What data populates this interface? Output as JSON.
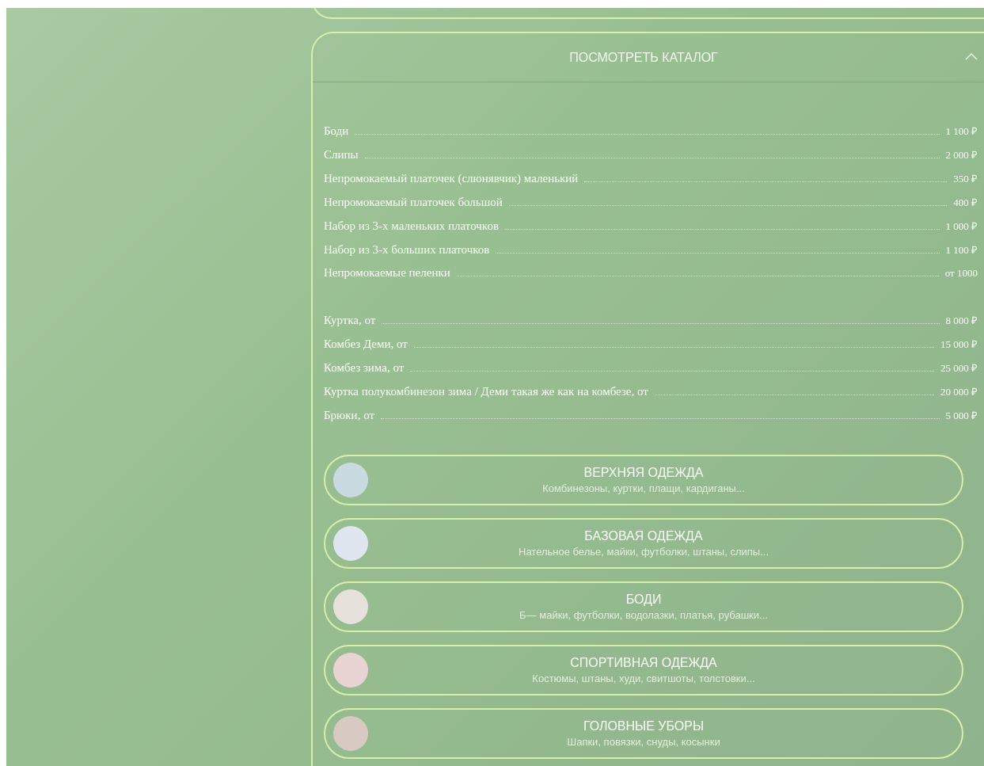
{
  "catalog": {
    "title": "ПОСМОТРЕТЬ КАТАЛОГ",
    "expanded": true,
    "price_groups": [
      {
        "items": [
          {
            "name": "Боди",
            "price": "1 100 ₽"
          },
          {
            "name": "Слипы",
            "price": "2 000 ₽"
          },
          {
            "name": "Непромокаемый платочек (слюнявчик) маленький",
            "price": "350 ₽"
          },
          {
            "name": "Непромокаемый платочек большой",
            "price": "400 ₽"
          },
          {
            "name": "Набор из 3-х маленьких платочков",
            "price": "1 000 ₽"
          },
          {
            "name": "Набор из 3-х больших платочков",
            "price": "1 100 ₽"
          },
          {
            "name": "Непромокаемые пеленки",
            "price": "от 1000"
          }
        ]
      },
      {
        "items": [
          {
            "name": "Куртка, от",
            "price": "8 000 ₽"
          },
          {
            "name": "Комбез Деми, от",
            "price": "15 000 ₽"
          },
          {
            "name": "Комбез зима, от",
            "price": "25 000 ₽"
          },
          {
            "name": "Куртка полукомбинезон зима / Деми такая же как на комбезе, от",
            "price": "20 000 ₽"
          },
          {
            "name": "Брюки, от",
            "price": "5 000 ₽"
          }
        ]
      }
    ],
    "categories": [
      {
        "title": "ВЕРХНЯЯ ОДЕЖДА",
        "subtitle": "Комбинезоны, куртки, плащи, кардиганы..."
      },
      {
        "title": "БАЗОВАЯ ОДЕЖДА",
        "subtitle": "Нательное белье, майки, футболки, штаны, слипы..."
      },
      {
        "title": "БОДИ",
        "subtitle": "Б— майки, футболки, водолазки, платья, рубашки..."
      },
      {
        "title": "СПОРТИВНАЯ ОДЕЖДА",
        "subtitle": "Костюмы, штаны, худи, свитшоты, толстовки..."
      },
      {
        "title": "ГОЛОВНЫЕ УБОРЫ",
        "subtitle": "Шапки, повязки, снуды, косынки"
      }
    ]
  }
}
